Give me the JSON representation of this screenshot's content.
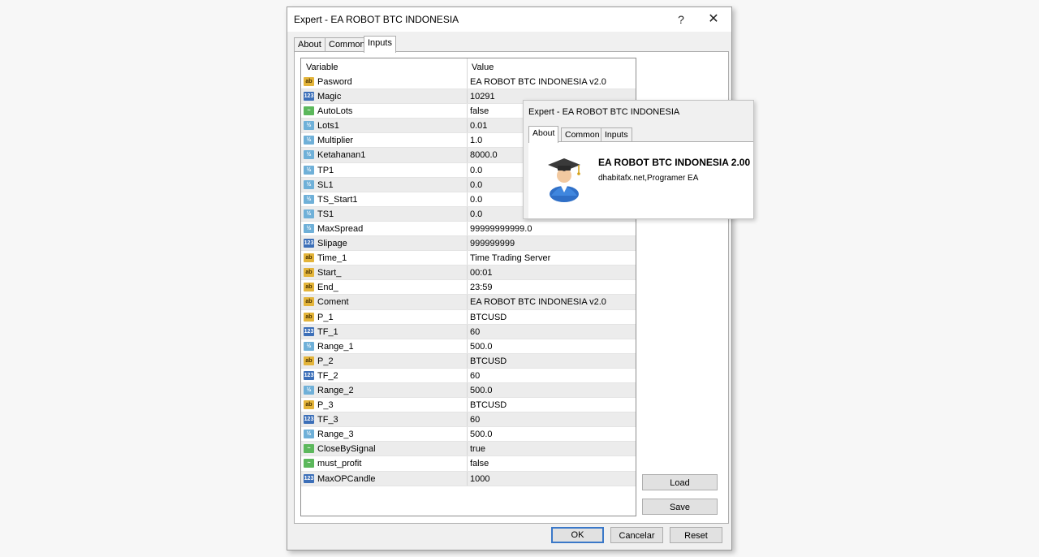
{
  "main_window": {
    "title": "Expert - EA ROBOT BTC INDONESIA",
    "help_glyph": "?",
    "close_glyph": "✕",
    "tabs": [
      {
        "label": "About",
        "active": false
      },
      {
        "label": "Common",
        "active": false
      },
      {
        "label": "Inputs",
        "active": true
      }
    ],
    "grid": {
      "header_variable": "Variable",
      "header_value": "Value",
      "rows": [
        {
          "type": "string",
          "icon": "ab",
          "variable": "Pasword",
          "value": "EA ROBOT BTC INDONESIA v2.0"
        },
        {
          "type": "int",
          "icon": "123",
          "variable": "Magic",
          "value": "10291"
        },
        {
          "type": "bool",
          "icon": "~",
          "variable": "AutoLots",
          "value": "false"
        },
        {
          "type": "double",
          "icon": "½",
          "variable": "Lots1",
          "value": "0.01"
        },
        {
          "type": "double",
          "icon": "½",
          "variable": "Multiplier",
          "value": "1.0"
        },
        {
          "type": "double",
          "icon": "½",
          "variable": "Ketahanan1",
          "value": "8000.0"
        },
        {
          "type": "double",
          "icon": "½",
          "variable": "TP1",
          "value": "0.0"
        },
        {
          "type": "double",
          "icon": "½",
          "variable": "SL1",
          "value": "0.0"
        },
        {
          "type": "double",
          "icon": "½",
          "variable": "TS_Start1",
          "value": "0.0"
        },
        {
          "type": "double",
          "icon": "½",
          "variable": "TS1",
          "value": "0.0"
        },
        {
          "type": "double",
          "icon": "½",
          "variable": "MaxSpread",
          "value": "99999999999.0"
        },
        {
          "type": "int",
          "icon": "123",
          "variable": "Slipage",
          "value": "999999999"
        },
        {
          "type": "string",
          "icon": "ab",
          "variable": "Time_1",
          "value": "Time  Trading Server"
        },
        {
          "type": "string",
          "icon": "ab",
          "variable": "Start_",
          "value": "00:01"
        },
        {
          "type": "string",
          "icon": "ab",
          "variable": "End_",
          "value": "23:59"
        },
        {
          "type": "string",
          "icon": "ab",
          "variable": "Coment",
          "value": "EA ROBOT BTC INDONESIA v2.0"
        },
        {
          "type": "string",
          "icon": "ab",
          "variable": "P_1",
          "value": "BTCUSD"
        },
        {
          "type": "int",
          "icon": "123",
          "variable": "TF_1",
          "value": "60"
        },
        {
          "type": "double",
          "icon": "½",
          "variable": "Range_1",
          "value": "500.0"
        },
        {
          "type": "string",
          "icon": "ab",
          "variable": "P_2",
          "value": "BTCUSD"
        },
        {
          "type": "int",
          "icon": "123",
          "variable": "TF_2",
          "value": "60"
        },
        {
          "type": "double",
          "icon": "½",
          "variable": "Range_2",
          "value": "500.0"
        },
        {
          "type": "string",
          "icon": "ab",
          "variable": "P_3",
          "value": "BTCUSD"
        },
        {
          "type": "int",
          "icon": "123",
          "variable": "TF_3",
          "value": "60"
        },
        {
          "type": "double",
          "icon": "½",
          "variable": "Range_3",
          "value": "500.0"
        },
        {
          "type": "bool",
          "icon": "~",
          "variable": "CloseBySignal",
          "value": "true"
        },
        {
          "type": "bool",
          "icon": "~",
          "variable": "must_profit",
          "value": "false"
        },
        {
          "type": "int",
          "icon": "123",
          "variable": "MaxOPCandle",
          "value": "1000"
        }
      ]
    },
    "buttons": {
      "load": "Load",
      "save": "Save",
      "ok": "OK",
      "cancel": "Cancelar",
      "reset": "Reset"
    }
  },
  "about_window": {
    "title": "Expert - EA ROBOT BTC INDONESIA",
    "tabs": [
      {
        "label": "About",
        "active": true
      },
      {
        "label": "Common",
        "active": false
      },
      {
        "label": "Inputs",
        "active": false
      }
    ],
    "ea_name": "EA ROBOT BTC INDONESIA 2.00",
    "author": "dhabitafx.net,Programer EA",
    "avatar_icon": "graduate-user-icon"
  }
}
